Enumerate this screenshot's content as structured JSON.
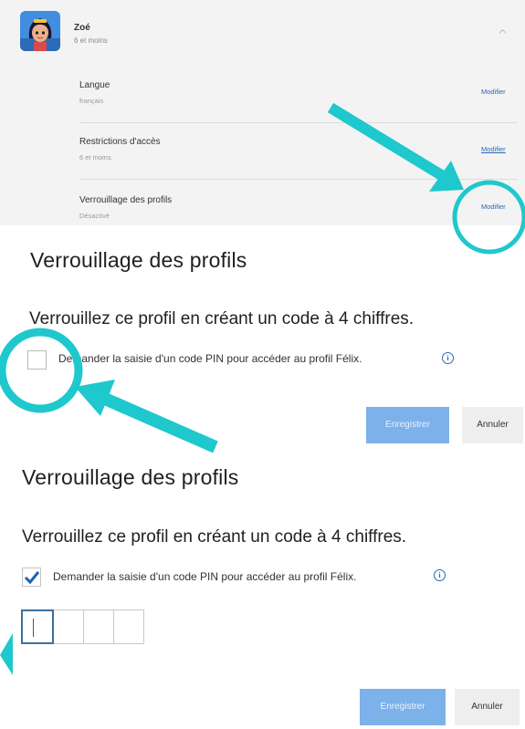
{
  "profile": {
    "name": "Zoé",
    "age_group": "6 et moins",
    "rows": [
      {
        "label": "Langue",
        "value": "français",
        "link": "Modifier"
      },
      {
        "label": "Restrictions d'accès",
        "value": "6 et moins.",
        "link": "Modifier"
      },
      {
        "label": "Verrouillage des profils",
        "value": "Désactivé",
        "link": "Modifier"
      }
    ]
  },
  "lock_dialog_before": {
    "title": "Verrouillage des profils",
    "subtitle": "Verrouillez ce profil en créant un code à 4 chiffres.",
    "checkbox_label": "Demander la saisie d'un code PIN pour accéder au profil Félix.",
    "checked": false,
    "save": "Enregistrer",
    "cancel": "Annuler"
  },
  "lock_dialog_after": {
    "title": "Verrouillage des profils",
    "subtitle": "Verrouillez ce profil en créant un code à 4 chiffres.",
    "checkbox_label": "Demander la saisie d'un code PIN pour accéder au profil Félix.",
    "checked": true,
    "save": "Enregistrer",
    "cancel": "Annuler"
  },
  "colors": {
    "annotation": "#1ec8cc",
    "link": "#2a67b8",
    "primary_button": "#7cb1ea"
  }
}
